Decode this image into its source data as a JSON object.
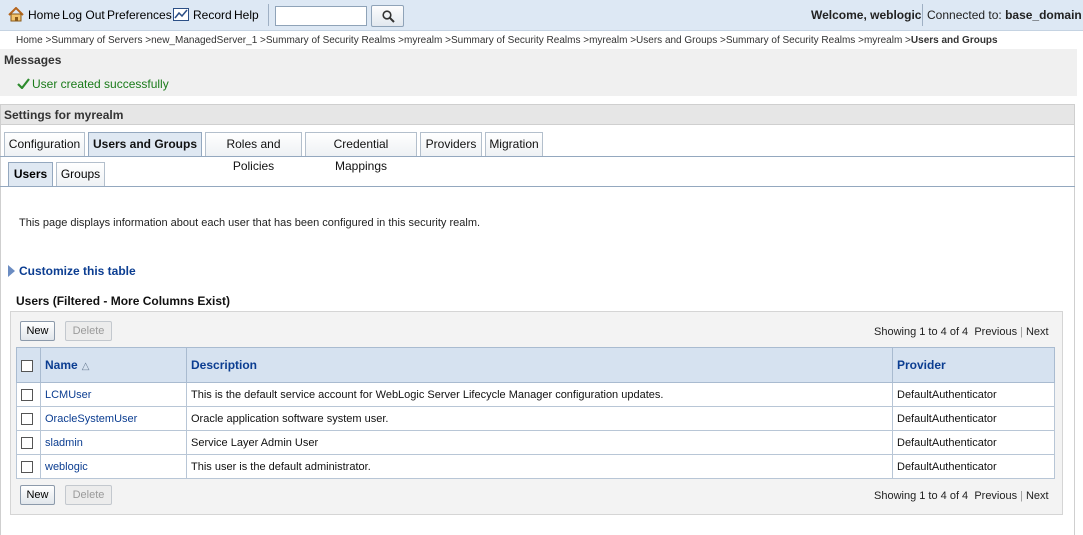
{
  "toolbar": {
    "home": "Home",
    "logout": "Log Out",
    "preferences": "Preferences",
    "record": "Record",
    "help": "Help",
    "search_value": "",
    "welcome": "Welcome, weblogic",
    "connected_label": "Connected to:",
    "domain": "base_domain"
  },
  "breadcrumb": {
    "items": [
      "Home",
      "Summary of Servers",
      "new_ManagedServer_1",
      "Summary of Security Realms",
      "myrealm",
      "Summary of Security Realms",
      "myrealm",
      "Users and Groups",
      "Summary of Security Realms",
      "myrealm"
    ],
    "current": "Users and Groups"
  },
  "messages": {
    "title": "Messages",
    "text": "User created successfully"
  },
  "settings": {
    "title": "Settings for myrealm",
    "tabs": [
      "Configuration",
      "Users and Groups",
      "Roles and Policies",
      "Credential Mappings",
      "Providers",
      "Migration"
    ],
    "subtabs": [
      "Users",
      "Groups"
    ]
  },
  "page": {
    "description": "This page displays information about each user that has been configured in this security realm.",
    "customize": "Customize this table",
    "table_caption": "Users (Filtered - More Columns Exist)"
  },
  "table": {
    "new_label": "New",
    "delete_label": "Delete",
    "showing": "Showing 1 to 4 of 4",
    "previous": "Previous",
    "next": "Next",
    "headers": {
      "name": "Name",
      "description": "Description",
      "provider": "Provider"
    },
    "rows": [
      {
        "name": "LCMUser",
        "description": "This is the default service account for WebLogic Server Lifecycle Manager configuration updates.",
        "provider": "DefaultAuthenticator"
      },
      {
        "name": "OracleSystemUser",
        "description": "Oracle application software system user.",
        "provider": "DefaultAuthenticator"
      },
      {
        "name": "sladmin",
        "description": "Service Layer Admin User",
        "provider": "DefaultAuthenticator"
      },
      {
        "name": "weblogic",
        "description": "This user is the default administrator.",
        "provider": "DefaultAuthenticator"
      }
    ]
  }
}
